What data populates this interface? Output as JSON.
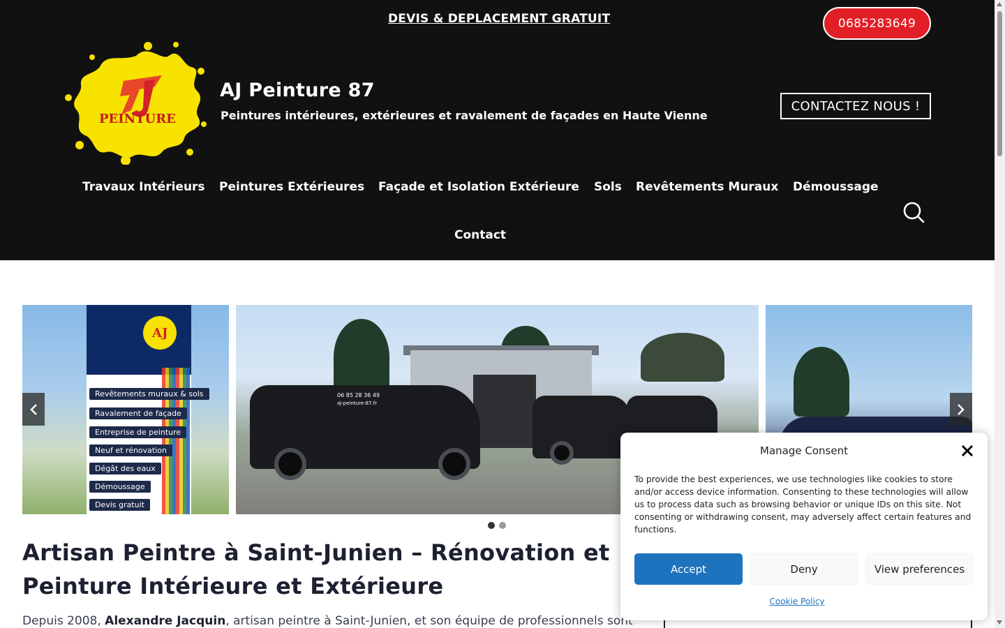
{
  "topbar": {
    "promo_link": "DEVIS & DEPLACEMENT GRATUIT",
    "phone_button": "0685283649"
  },
  "branding": {
    "logo_text_initials": "AJ",
    "logo_text_word": "PEINTURE",
    "site_title": "AJ Peinture 87",
    "tagline": "Peintures intérieures, extérieures et ravalement de façades en Haute Vienne",
    "contact_button": "CONTACTEZ NOUS !"
  },
  "nav": {
    "items": [
      "Travaux Intérieurs",
      "Peintures Extérieures",
      "Façade et Isolation Extérieure",
      "Sols",
      "Revêtements Muraux",
      "Démoussage",
      "Contact"
    ],
    "search_icon": "search-icon"
  },
  "slider": {
    "slide_left_sign_items": [
      "Revêtements muraux & sols",
      "Ravalement de façade",
      "Entreprise de peinture",
      "Neuf et rénovation",
      "Dégât des eaux",
      "Démoussage",
      "Devis gratuit"
    ],
    "van_phone": "06 85 28 36 49",
    "van_url": "aj-peinture-87.fr",
    "dots_count": 2,
    "active_dot": 0
  },
  "content": {
    "heading": "Artisan Peintre à Saint-Junien – Rénovation et Peinture Intérieure et Extérieure",
    "intro_prefix": "Depuis 2008, ",
    "intro_name": "Alexandre Jacquin",
    "intro_suffix": ", artisan peintre à Saint-Junien, et son équipe de professionnels sont"
  },
  "consent": {
    "title": "Manage Consent",
    "text": "To provide the best experiences, we use technologies like cookies to store and/or access device information. Consenting to these technologies will allow us to process data such as browsing behavior or unique IDs on this site. Not consenting or withdrawing consent, may adversely affect certain features and functions.",
    "accept": "Accept",
    "deny": "Deny",
    "preferences": "View preferences",
    "policy_link": "Cookie Policy"
  },
  "colors": {
    "header_bg": "#111111",
    "brand_red": "#e21f26",
    "accept_blue": "#1e73be",
    "logo_yellow": "#f7e200"
  }
}
